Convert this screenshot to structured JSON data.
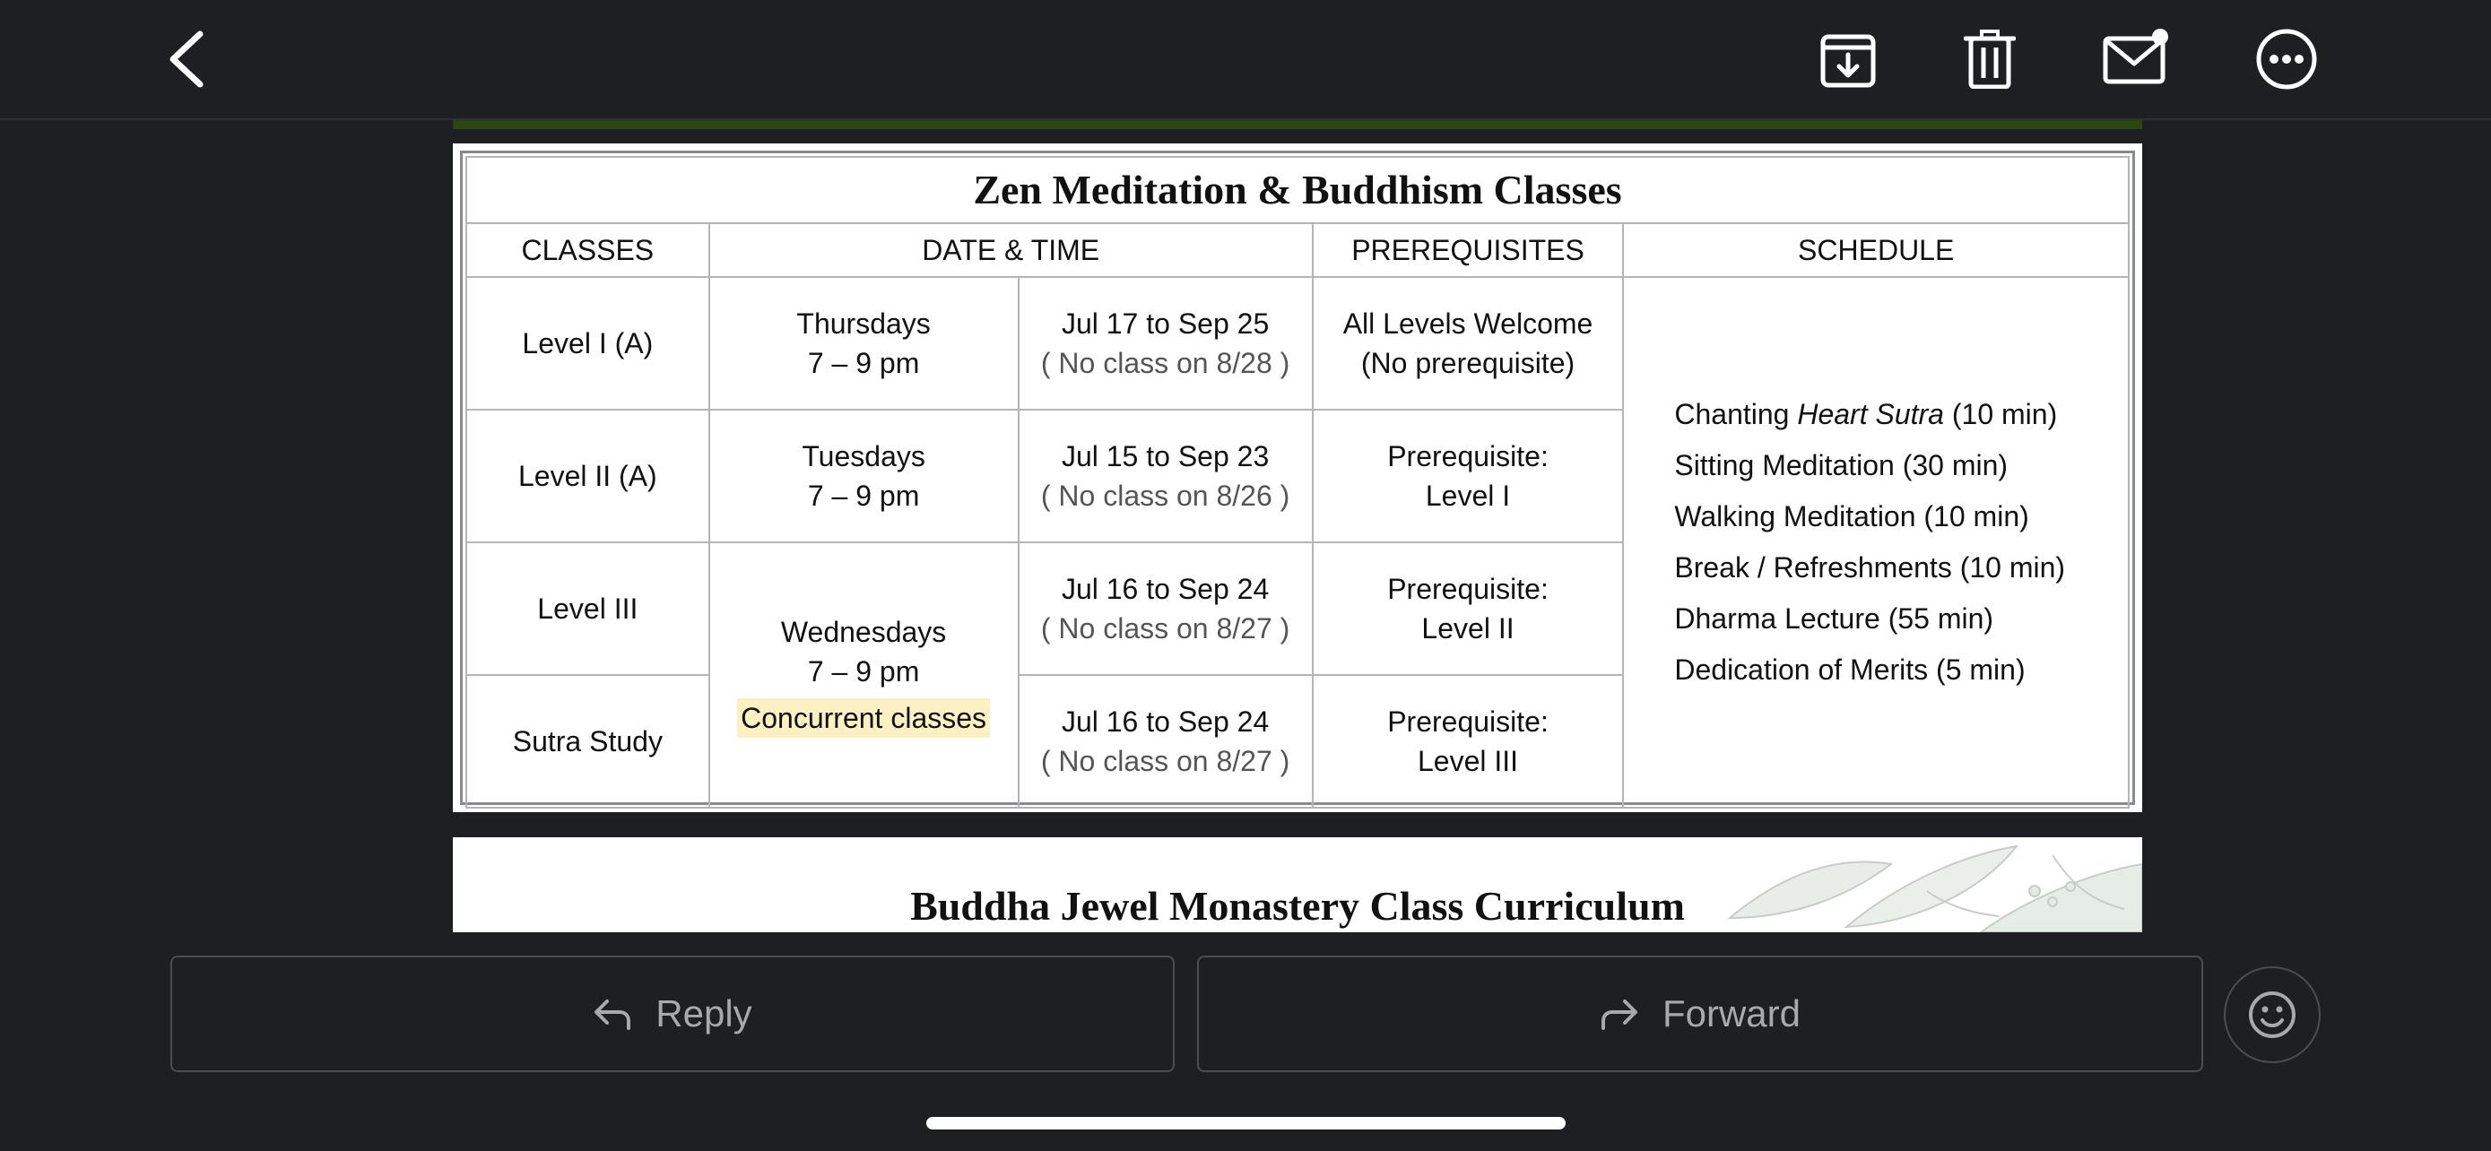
{
  "topbar": {
    "icons": [
      "chevron-left-icon",
      "archive-download-icon",
      "trash-icon",
      "mail-unread-icon",
      "more-options-icon"
    ]
  },
  "classes_table": {
    "title": "Zen Meditation & Buddhism Classes",
    "headers": [
      "CLASSES",
      "DATE & TIME",
      "PREREQUISITES",
      "SCHEDULE"
    ],
    "rows": [
      {
        "class": "Level I (A)",
        "day": "Thursdays",
        "time": "7 – 9 pm",
        "dates": "Jul 17 to Sep 25",
        "note": "( No class on 8/28 )",
        "prereq_line1": "All Levels Welcome",
        "prereq_line2": "(No prerequisite)"
      },
      {
        "class": "Level II (A)",
        "day": "Tuesdays",
        "time": "7 – 9 pm",
        "dates": "Jul 15 to Sep 23",
        "note": "( No class on 8/26 )",
        "prereq_line1": "Prerequisite:",
        "prereq_line2": "Level I"
      },
      {
        "class": "Level III",
        "dates": "Jul 16 to Sep 24",
        "note": "( No class on 8/27 )",
        "prereq_line1": "Prerequisite:",
        "prereq_line2": "Level II"
      },
      {
        "class": "Sutra Study",
        "dates": "Jul 16 to Sep 24",
        "note": "( No class on 8/27 )",
        "prereq_line1": "Prerequisite:",
        "prereq_line2": "Level III"
      }
    ],
    "shared_day": "Wednesdays",
    "shared_time": "7 – 9 pm",
    "shared_note": "Concurrent classes",
    "schedule": {
      "item1_prefix": "Chanting ",
      "item1_italic": "Heart Sutra",
      "item1_suffix": " (10 min)",
      "item2": "Sitting Meditation (30 min)",
      "item3": "Walking Meditation (10 min)",
      "item4": "Break / Refreshments (10 min)",
      "item5": "Dharma Lecture (55 min)",
      "item6": "Dedication of Merits (5 min)"
    },
    "colors": {
      "highlight": "#fdf1c4",
      "header_strip": "#2c4610"
    }
  },
  "curriculum": {
    "title": "Buddha Jewel Monastery Class Curriculum"
  },
  "actions": {
    "reply_label": "Reply",
    "forward_label": "Forward",
    "emoji_icon": "emoji-smile-icon"
  }
}
